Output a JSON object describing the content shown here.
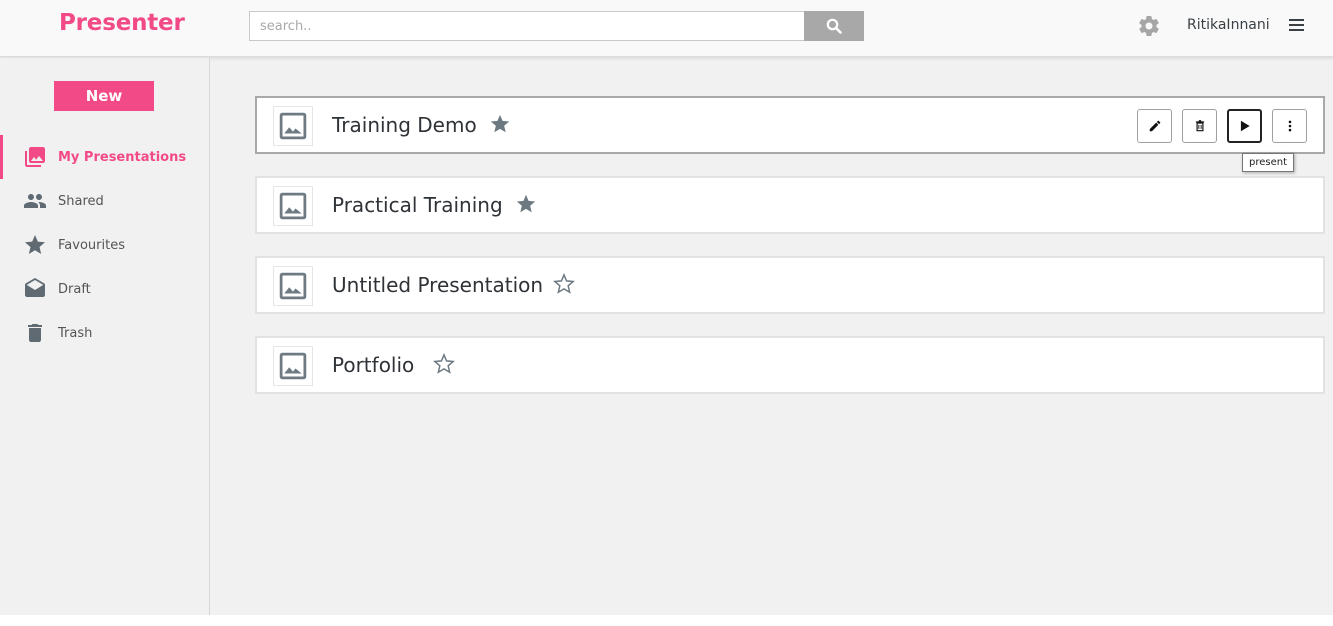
{
  "app": {
    "logo": "Presenter"
  },
  "header": {
    "search_placeholder": "search..",
    "username": "RitikaInnani"
  },
  "sidebar": {
    "new_label": "New",
    "items": [
      {
        "label": "My Presentations",
        "icon": "presentations-icon",
        "active": true
      },
      {
        "label": "Shared",
        "icon": "people-icon",
        "active": false
      },
      {
        "label": "Favourites",
        "icon": "star-icon",
        "active": false
      },
      {
        "label": "Draft",
        "icon": "envelope-open-icon",
        "active": false
      },
      {
        "label": "Trash",
        "icon": "trash-icon",
        "active": false
      }
    ]
  },
  "presentations": [
    {
      "title": "Training Demo",
      "starred": true
    },
    {
      "title": "Practical Training",
      "starred": true
    },
    {
      "title": "Untitled Presentation",
      "starred": false
    },
    {
      "title": "Portfolio",
      "starred": false
    }
  ],
  "actions": {
    "tooltip": "present"
  },
  "colors": {
    "brand": "#f24a86",
    "icon_gray": "#6d7a82"
  }
}
